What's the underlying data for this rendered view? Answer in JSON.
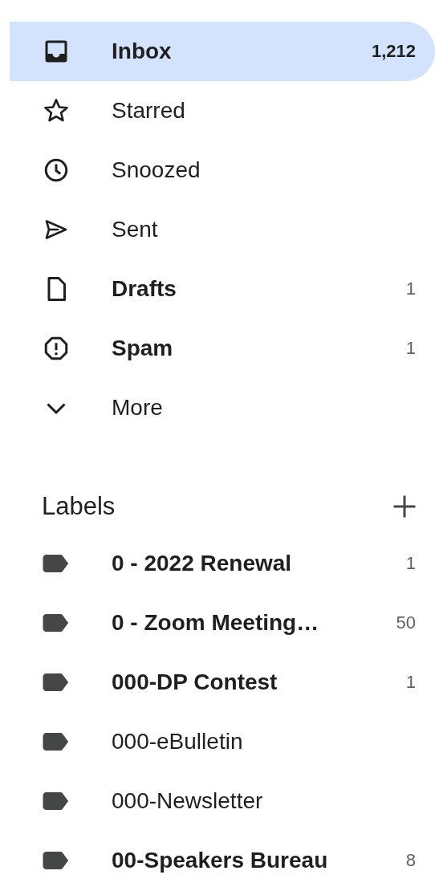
{
  "folders": [
    {
      "kind": "inbox",
      "label": "Inbox",
      "count": "1,212",
      "selected": true,
      "unread": true
    },
    {
      "kind": "star",
      "label": "Starred",
      "selected": false,
      "unread": false
    },
    {
      "kind": "clock",
      "label": "Snoozed",
      "selected": false,
      "unread": false
    },
    {
      "kind": "send",
      "label": "Sent",
      "selected": false,
      "unread": false
    },
    {
      "kind": "file",
      "label": "Drafts",
      "count": "1",
      "selected": false,
      "unread": true
    },
    {
      "kind": "alert",
      "label": "Spam",
      "count": "1",
      "selected": false,
      "unread": true
    },
    {
      "kind": "chevron",
      "label": "More",
      "selected": false,
      "unread": false
    }
  ],
  "labels": {
    "title": "Labels",
    "items": [
      {
        "name": "0 - 2022 Renewal",
        "count": "1",
        "unread": true
      },
      {
        "name": "0 - Zoom Meeting…",
        "count": "50",
        "unread": true
      },
      {
        "name": "000-DP Contest",
        "count": "1",
        "unread": true
      },
      {
        "name": "000-eBulletin",
        "unread": false
      },
      {
        "name": "000-Newsletter",
        "unread": false
      },
      {
        "name": "00-Speakers Bureau",
        "count": "8",
        "unread": true
      }
    ]
  }
}
